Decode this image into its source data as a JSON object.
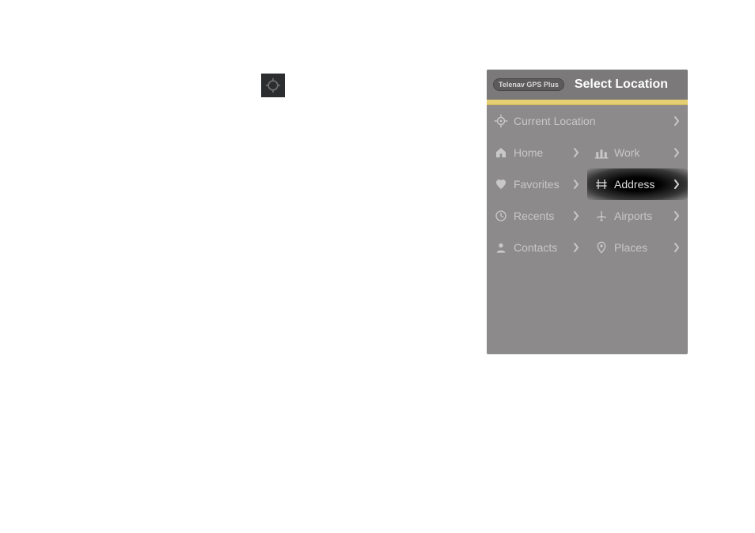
{
  "standalone_icon": "target-icon",
  "header": {
    "badge": "Telenav GPS Plus",
    "title": "Select Location"
  },
  "colors": {
    "accent": "#e6cf73",
    "panel_bg": "#8c8a8a",
    "header_bg": "#7b7979",
    "text": "#c9c8c8",
    "title": "#ffffff",
    "highlight_bg": "#000000"
  },
  "items": {
    "current_location": "Current Location",
    "home": "Home",
    "work": "Work",
    "favorites": "Favorites",
    "address": "Address",
    "recents": "Recents",
    "airports": "Airports",
    "contacts": "Contacts",
    "places": "Places"
  }
}
